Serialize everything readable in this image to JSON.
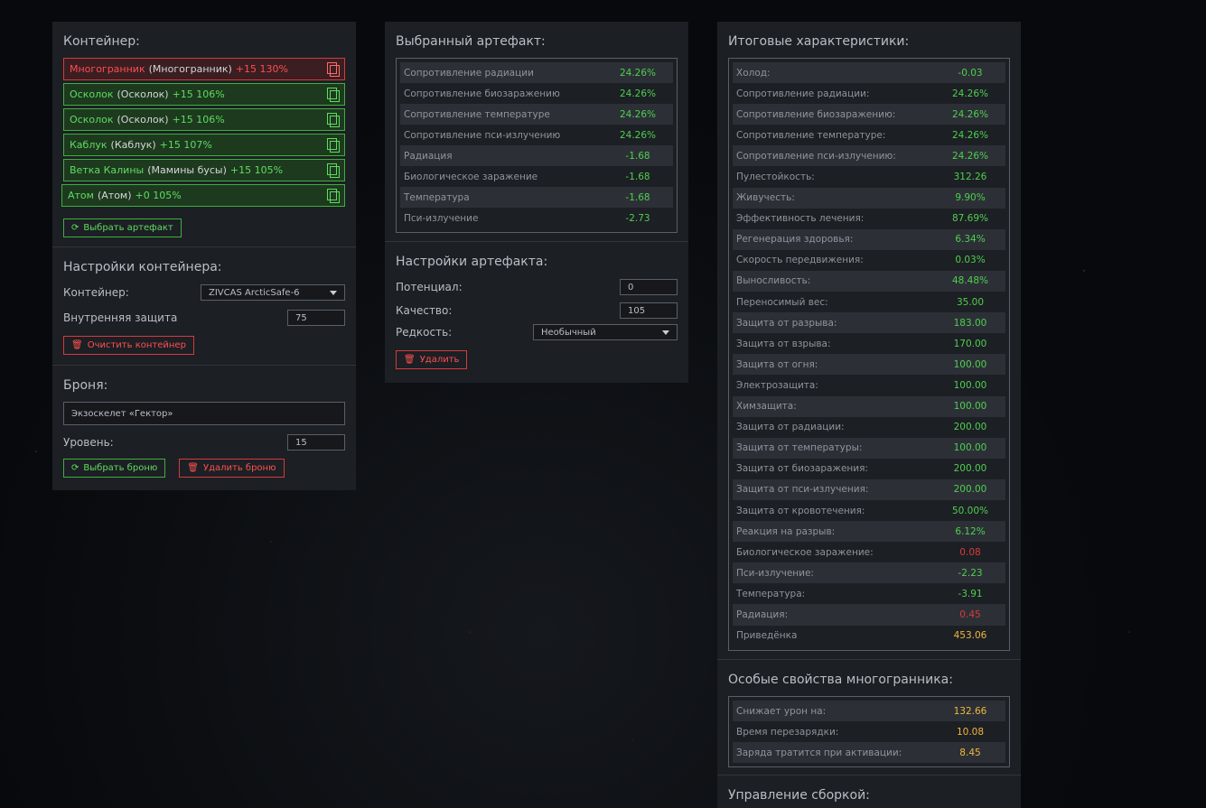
{
  "container_panel": {
    "title": "Контейнер:",
    "slots": [
      {
        "name": "Многогранник",
        "sub": "(Многогранник)",
        "level": "+15 130%",
        "state": "red"
      },
      {
        "name": "Осколок",
        "sub": "(Осколок)",
        "level": "+15 106%",
        "state": "green"
      },
      {
        "name": "Осколок",
        "sub": "(Осколок)",
        "level": "+15 106%",
        "state": "green"
      },
      {
        "name": "Каблук",
        "sub": "(Каблук)",
        "level": "+15 107%",
        "state": "green"
      },
      {
        "name": "Ветка Калины",
        "sub": "(Мамины бусы)",
        "level": "+15 105%",
        "state": "green"
      },
      {
        "name": "Атом",
        "sub": "(Атом)",
        "level": "+0 105%",
        "state": "green"
      }
    ],
    "choose_artifact_btn": "Выбрать артефакт",
    "settings_title": "Настройки контейнера:",
    "container_label": "Контейнер:",
    "container_value": "ZIVCAS ArcticSafe-6",
    "inner_protection_label": "Внутренняя защита",
    "inner_protection_value": "75",
    "clear_btn": "Очистить контейнер",
    "armor_title": "Броня:",
    "armor_value": "Экзоскелет «Гектор»",
    "level_label": "Уровень:",
    "level_value": "15",
    "choose_armor_btn": "Выбрать броню",
    "delete_armor_btn": "Удалить броню"
  },
  "artifact_panel": {
    "title": "Выбранный артефакт:",
    "stats": [
      {
        "label": "Сопротивление радиации",
        "value": "24.26%",
        "color": "pos"
      },
      {
        "label": "Сопротивление биозаражению",
        "value": "24.26%",
        "color": "pos"
      },
      {
        "label": "Сопротивление температуре",
        "value": "24.26%",
        "color": "pos"
      },
      {
        "label": "Сопротивление пси-излучению",
        "value": "24.26%",
        "color": "pos"
      },
      {
        "label": "Радиация",
        "value": "-1.68",
        "color": "pos"
      },
      {
        "label": "Биологическое заражение",
        "value": "-1.68",
        "color": "pos"
      },
      {
        "label": "Температура",
        "value": "-1.68",
        "color": "pos"
      },
      {
        "label": "Пси-излучение",
        "value": "-2.73",
        "color": "pos"
      }
    ],
    "settings_title": "Настройки артефакта:",
    "potential_label": "Потенциал:",
    "potential_value": "0",
    "quality_label": "Качество:",
    "quality_value": "105",
    "rarity_label": "Редкость:",
    "rarity_value": "Необычный",
    "delete_btn": "Удалить"
  },
  "totals_panel": {
    "title": "Итоговые характеристики:",
    "stats": [
      {
        "label": "Холод:",
        "value": "-0.03",
        "color": "pos"
      },
      {
        "label": "Сопротивление радиации:",
        "value": "24.26%",
        "color": "pos"
      },
      {
        "label": "Сопротивление биозаражению:",
        "value": "24.26%",
        "color": "pos"
      },
      {
        "label": "Сопротивление температуре:",
        "value": "24.26%",
        "color": "pos"
      },
      {
        "label": "Сопротивление пси-излучению:",
        "value": "24.26%",
        "color": "pos"
      },
      {
        "label": "Пулестойкость:",
        "value": "312.26",
        "color": "pos"
      },
      {
        "label": "Живучесть:",
        "value": "9.90%",
        "color": "pos"
      },
      {
        "label": "Эффективность лечения:",
        "value": "87.69%",
        "color": "pos"
      },
      {
        "label": "Регенерация здоровья:",
        "value": "6.34%",
        "color": "pos"
      },
      {
        "label": "Скорость передвижения:",
        "value": "0.03%",
        "color": "pos"
      },
      {
        "label": "Выносливость:",
        "value": "48.48%",
        "color": "pos"
      },
      {
        "label": "Переносимый вес:",
        "value": "35.00",
        "color": "pos"
      },
      {
        "label": "Защита от разрыва:",
        "value": "183.00",
        "color": "pos"
      },
      {
        "label": "Защита от взрыва:",
        "value": "170.00",
        "color": "pos"
      },
      {
        "label": "Защита от огня:",
        "value": "100.00",
        "color": "pos"
      },
      {
        "label": "Электрозащита:",
        "value": "100.00",
        "color": "pos"
      },
      {
        "label": "Химзащита:",
        "value": "100.00",
        "color": "pos"
      },
      {
        "label": "Защита от радиации:",
        "value": "200.00",
        "color": "pos"
      },
      {
        "label": "Защита от температуры:",
        "value": "100.00",
        "color": "pos"
      },
      {
        "label": "Защита от биозаражения:",
        "value": "200.00",
        "color": "pos"
      },
      {
        "label": "Защита от пси-излучения:",
        "value": "200.00",
        "color": "pos"
      },
      {
        "label": "Защита от кровотечения:",
        "value": "50.00%",
        "color": "pos"
      },
      {
        "label": "Реакция на разрыв:",
        "value": "6.12%",
        "color": "pos"
      },
      {
        "label": "Биологическое заражение:",
        "value": "0.08",
        "color": "neg"
      },
      {
        "label": "Пси-излучение:",
        "value": "-2.23",
        "color": "pos"
      },
      {
        "label": "Температура:",
        "value": "-3.91",
        "color": "pos"
      },
      {
        "label": "Радиация:",
        "value": "0.45",
        "color": "neg"
      },
      {
        "label": "Приведёнка",
        "value": "453.06",
        "color": "yel"
      }
    ],
    "special_title": "Особые свойства многогранника:",
    "special_stats": [
      {
        "label": "Снижает урон на:",
        "value": "132.66",
        "color": "yel"
      },
      {
        "label": "Время перезарядки:",
        "value": "10.08",
        "color": "yel"
      },
      {
        "label": "Заряда тратится при активации:",
        "value": "8.45",
        "color": "yel"
      }
    ],
    "build_title": "Управление сборкой:"
  }
}
